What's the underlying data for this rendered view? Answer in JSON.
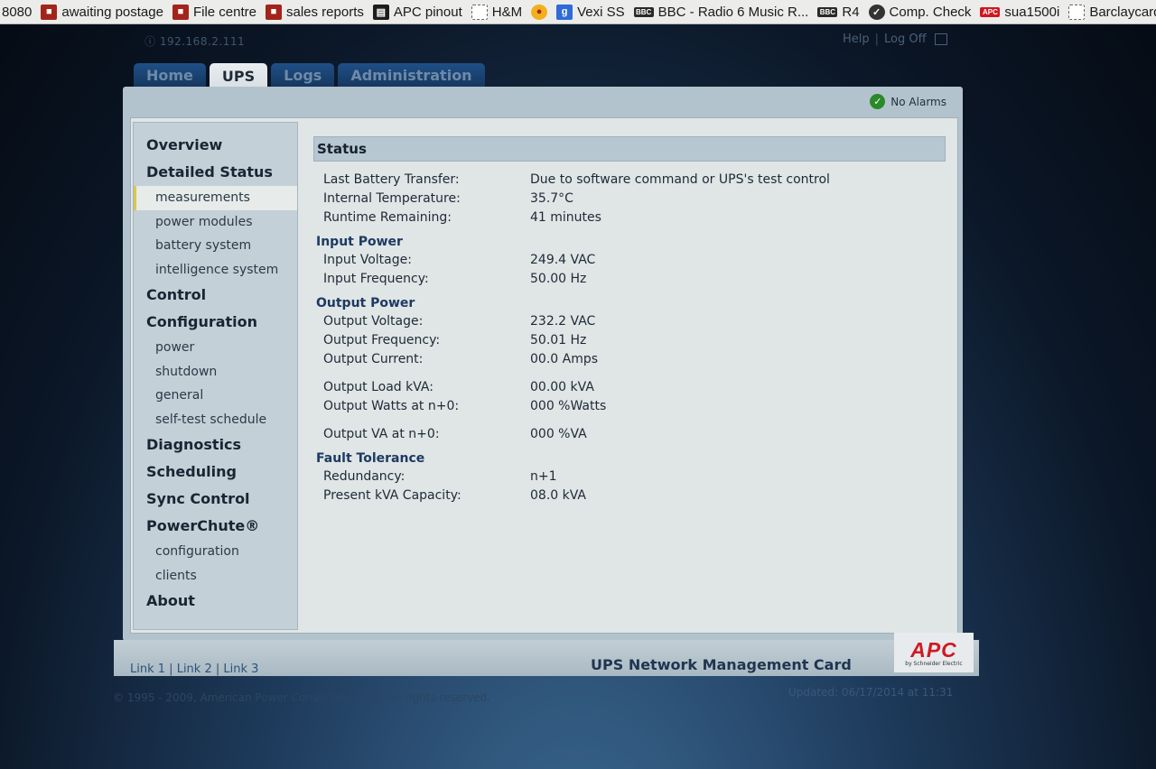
{
  "bookmarks": [
    {
      "label": "8080",
      "icon": "none"
    },
    {
      "label": "awaiting postage",
      "icon": "briefcase-icon"
    },
    {
      "label": "File centre",
      "icon": "briefcase-icon"
    },
    {
      "label": "sales reports",
      "icon": "briefcase-icon"
    },
    {
      "label": "APC pinout",
      "icon": "document-icon"
    },
    {
      "label": "H&M",
      "icon": "blank-page-icon"
    },
    {
      "label": "",
      "icon": "sun-icon"
    },
    {
      "label": "Vexi SS",
      "icon": "google-icon"
    },
    {
      "label": "BBC - Radio 6 Music R...",
      "icon": "bbc-icon"
    },
    {
      "label": "R4",
      "icon": "bbc-icon"
    },
    {
      "label": "Comp. Check",
      "icon": "check-icon"
    },
    {
      "label": "sua1500i",
      "icon": "apc-icon"
    },
    {
      "label": "Barclaycard",
      "icon": "blank-page-icon"
    }
  ],
  "header": {
    "ip": "192.168.2.111",
    "help": "Help",
    "separator": "|",
    "logoff": "Log Off"
  },
  "tabs": [
    {
      "label": "Home",
      "active": false
    },
    {
      "label": "UPS",
      "active": true
    },
    {
      "label": "Logs",
      "active": false
    },
    {
      "label": "Administration",
      "active": false
    }
  ],
  "alarm": {
    "text": "No Alarms",
    "icon": "check-circle-icon",
    "color": "#2a8a2a"
  },
  "sidebar": {
    "overview": "Overview",
    "detailed_status": "Detailed Status",
    "measurements": "measurements",
    "power_modules": "power modules",
    "battery_system": "battery system",
    "intelligence_system": "intelligence system",
    "control": "Control",
    "configuration": "Configuration",
    "power": "power",
    "shutdown": "shutdown",
    "general": "general",
    "self_test_schedule": "self-test schedule",
    "diagnostics": "Diagnostics",
    "scheduling": "Scheduling",
    "sync_control": "Sync Control",
    "powerchute": "PowerChute®",
    "pc_configuration": "configuration",
    "clients": "clients",
    "about": "About"
  },
  "status": {
    "title": "Status",
    "last_battery_transfer": {
      "label": "Last Battery Transfer:",
      "value": "Due to software command or UPS's test control"
    },
    "internal_temperature": {
      "label": "Internal Temperature:",
      "value": "35.7°C"
    },
    "runtime_remaining": {
      "label": "Runtime Remaining:",
      "value": "41 minutes"
    },
    "input_power_title": "Input Power",
    "input_voltage": {
      "label": "Input Voltage:",
      "value": "249.4 VAC"
    },
    "input_frequency": {
      "label": "Input Frequency:",
      "value": "50.00 Hz"
    },
    "output_power_title": "Output Power",
    "output_voltage": {
      "label": "Output Voltage:",
      "value": "232.2 VAC"
    },
    "output_frequency": {
      "label": "Output Frequency:",
      "value": "50.01 Hz"
    },
    "output_current": {
      "label": "Output Current:",
      "value": "00.0 Amps"
    },
    "output_load_kva": {
      "label": "Output Load kVA:",
      "value": "00.00 kVA"
    },
    "output_watts": {
      "label": "Output Watts at n+0:",
      "value": "000 %Watts"
    },
    "output_va": {
      "label": "Output VA at n+0:",
      "value": "000 %VA"
    },
    "fault_tolerance_title": "Fault Tolerance",
    "redundancy": {
      "label": "Redundancy:",
      "value": "n+1"
    },
    "present_kva_capacity": {
      "label": "Present kVA Capacity:",
      "value": "08.0 kVA"
    }
  },
  "footer": {
    "link1": "Link 1",
    "link2": "Link 2",
    "link3": "Link 3",
    "sep": "|",
    "title": "UPS Network Management Card",
    "logo_text": "APC",
    "logo_sub": "by Schneider Electric",
    "copyright": "© 1995 - 2009, American Power Conversion Corp. All rights reserved.",
    "updated": "Updated: 06/17/2014 at 11:31"
  },
  "colors": {
    "brand_red": "#cf1a22",
    "tab_active_bg": "#e1e6e9",
    "link_blue": "#2c5379"
  }
}
